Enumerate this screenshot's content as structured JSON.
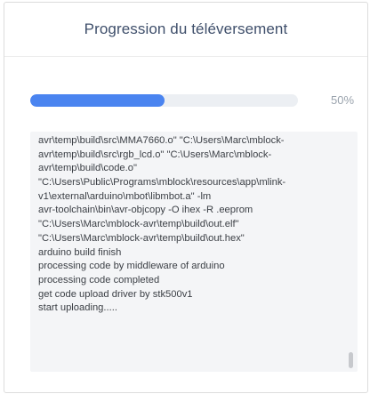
{
  "dialog": {
    "title": "Progression du téléversement"
  },
  "progress": {
    "value": 0.5,
    "label": "50%",
    "fill_color": "#4a84f0",
    "track_color": "#eceff3"
  },
  "log": {
    "lines": [
      "avr\\temp\\build\\src\\MMA7660.o\" \"C:\\Users\\Marc\\mblock-",
      "avr\\temp\\build\\src\\rgb_lcd.o\" \"C:\\Users\\Marc\\mblock-",
      "avr\\temp\\build\\code.o\"",
      "\"C:\\Users\\Public\\Programs\\mblock\\resources\\app\\mlink-",
      "v1\\external\\arduino\\mbot\\libmbot.a\" -lm",
      "avr-toolchain\\bin\\avr-objcopy -O ihex -R .eeprom",
      "\"C:\\Users\\Marc\\mblock-avr\\temp\\build\\out.elf\"",
      "\"C:\\Users\\Marc\\mblock-avr\\temp\\build\\out.hex\"",
      "arduino build finish",
      "processing code by middleware of arduino",
      "processing code completed",
      "get code upload driver by stk500v1",
      "start uploading....."
    ]
  }
}
